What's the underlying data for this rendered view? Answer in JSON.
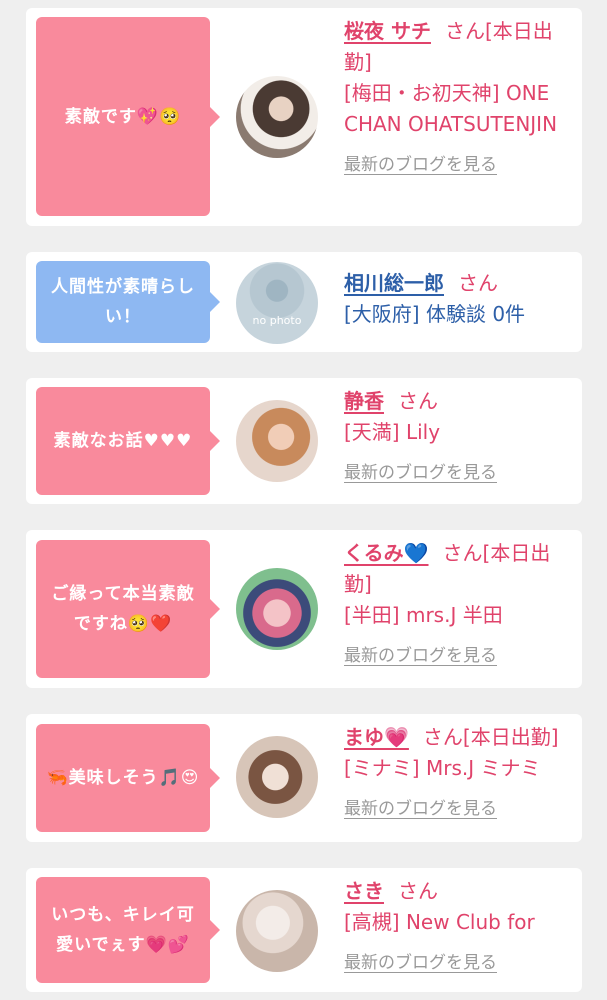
{
  "cards": [
    {
      "bubble": "素敵です💖🥺",
      "name": "桜夜 サチ",
      "suffix": "さん[本日出勤]",
      "shop": "[梅田・お初天神] ONE CHAN OHATSUTENJIN",
      "blog": "最新のブログを見る"
    },
    {
      "bubble": "人間性が素晴らしい！",
      "name": "相川総一郎",
      "suffix": "さん",
      "shop": "[大阪府] 体験談 0件",
      "avatar_text": "no photo"
    },
    {
      "bubble": "素敵なお話♥♥♥",
      "name": "静香",
      "suffix": "さん",
      "shop": "[天満] Lily",
      "blog": "最新のブログを見る"
    },
    {
      "bubble": "ご縁って本当素敵ですね🥺❤️",
      "name": "くるみ💙",
      "suffix": "さん[本日出勤]",
      "shop": "[半田] mrs.J 半田",
      "blog": "最新のブログを見る"
    },
    {
      "bubble": "🦐美味しそう🎵😍",
      "name": "まゆ💗",
      "suffix": "さん[本日出勤]",
      "shop": "[ミナミ] Mrs.J ミナミ",
      "blog": "最新のブログを見る"
    },
    {
      "bubble": "いつも、キレイ可愛いでぇす💗💕",
      "name": "さき",
      "suffix": "さん",
      "shop": "[高槻] New Club for",
      "blog": "最新のブログを見る"
    }
  ],
  "colors": {
    "pink": "#f98a9c",
    "blue": "#8eb8f2",
    "name_pink": "#e0436b",
    "name_blue": "#2d5fa8"
  }
}
